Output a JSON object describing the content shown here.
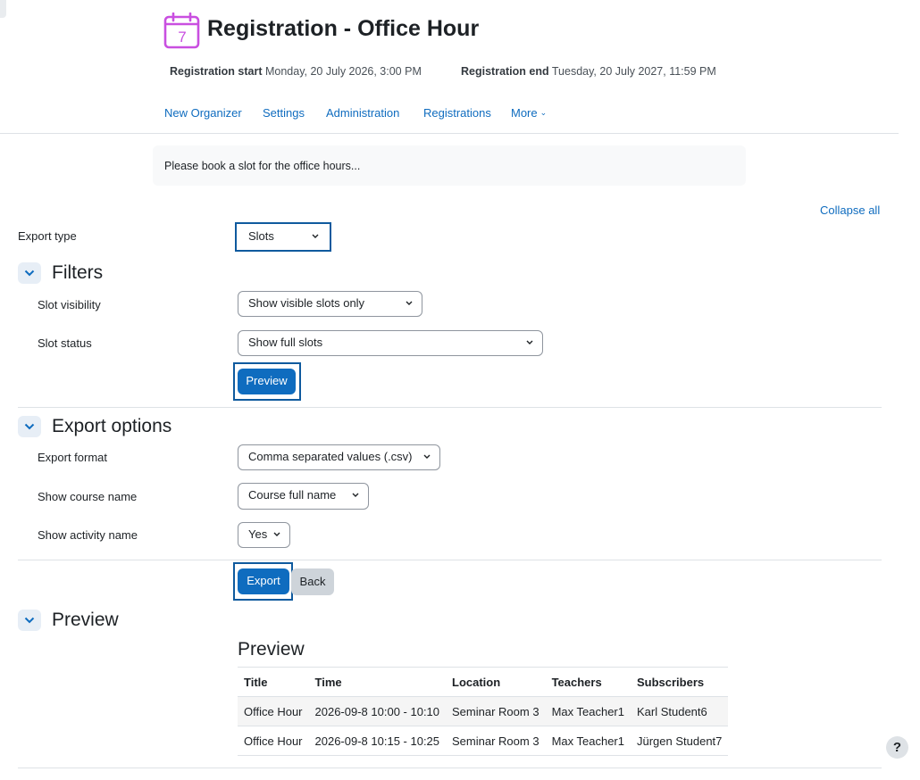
{
  "header": {
    "title": "Registration - Office Hour",
    "calendar_day": "7",
    "registration_start_label": "Registration start",
    "registration_start_value": "Monday, 20 July 2026, 3:00 PM",
    "registration_end_label": "Registration end",
    "registration_end_value": "Tuesday, 20 July 2027, 11:59 PM"
  },
  "nav": {
    "items": [
      {
        "label": "New Organizer"
      },
      {
        "label": "Settings"
      },
      {
        "label": "Administration"
      },
      {
        "label": "Registrations"
      },
      {
        "label": "More"
      }
    ]
  },
  "intro": {
    "text": "Please book a slot for the office hours..."
  },
  "form": {
    "collapse_all": "Collapse all",
    "export_type": {
      "label": "Export type",
      "value": "Slots"
    },
    "filters": {
      "title": "Filters",
      "slot_visibility": {
        "label": "Slot visibility",
        "value": "Show visible slots only"
      },
      "slot_status": {
        "label": "Slot status",
        "value": "Show full slots"
      },
      "preview_button": "Preview"
    },
    "export_options": {
      "title": "Export options",
      "export_format": {
        "label": "Export format",
        "value": "Comma separated values (.csv)"
      },
      "show_course_name": {
        "label": "Show course name",
        "value": "Course full name"
      },
      "show_activity_name": {
        "label": "Show activity name",
        "value": "Yes"
      }
    },
    "export_button": "Export",
    "back_button": "Back"
  },
  "preview": {
    "section_title": "Preview",
    "heading": "Preview",
    "columns": [
      "Title",
      "Time",
      "Location",
      "Teachers",
      "Subscribers"
    ],
    "rows": [
      [
        "Office Hour",
        "2026-09-8 10:00 - 10:10",
        "Seminar Room 3",
        "Max Teacher1",
        "Karl Student6"
      ],
      [
        "Office Hour",
        "2026-09-8 10:15 - 10:25",
        "Seminar Room 3",
        "Max Teacher1",
        "Jürgen Student7"
      ]
    ]
  },
  "help": {
    "label": "?"
  },
  "colors": {
    "accent": "#0f6cbf",
    "calendar_icon": "#c94fe0",
    "focus_ring": "#0f5a9e"
  }
}
